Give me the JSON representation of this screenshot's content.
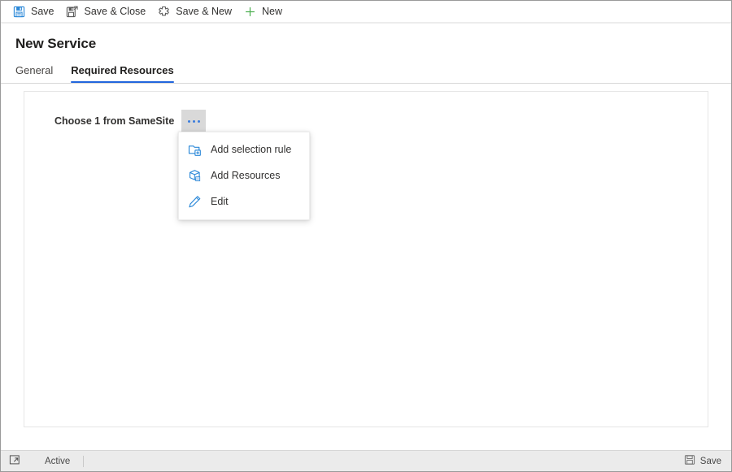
{
  "commandbar": {
    "buttons": [
      {
        "label": "Save",
        "icon": "save-floppy-icon"
      },
      {
        "label": "Save & Close",
        "icon": "save-close-floppy-icon"
      },
      {
        "label": "Save & New",
        "icon": "save-new-burst-icon"
      },
      {
        "label": "New",
        "icon": "plus-icon"
      }
    ]
  },
  "header": {
    "title": "New Service",
    "tabs": [
      {
        "label": "General",
        "active": false
      },
      {
        "label": "Required Resources",
        "active": true
      }
    ]
  },
  "form": {
    "field_label": "Choose 1 from SameSite",
    "ellipsis_button_name": "more-options"
  },
  "context_menu": {
    "items": [
      {
        "label": "Add selection rule",
        "icon": "add-selection-rule-icon"
      },
      {
        "label": "Add Resources",
        "icon": "add-resources-box-icon"
      },
      {
        "label": "Edit",
        "icon": "edit-pencil-icon"
      }
    ]
  },
  "statusbar": {
    "expand_icon": "expand-icon",
    "status_text": "Active",
    "save_label": "Save",
    "save_icon": "save-floppy-icon"
  },
  "colors": {
    "accent_blue": "#2266dd",
    "icon_blue": "#0078d4",
    "plus_green": "#4caf50",
    "toolbar_divider": "#ececec",
    "panel_border": "#e6e6e6",
    "statusbar_bg": "#ebebeb",
    "ellipsis_bg": "#d9d9d9"
  }
}
